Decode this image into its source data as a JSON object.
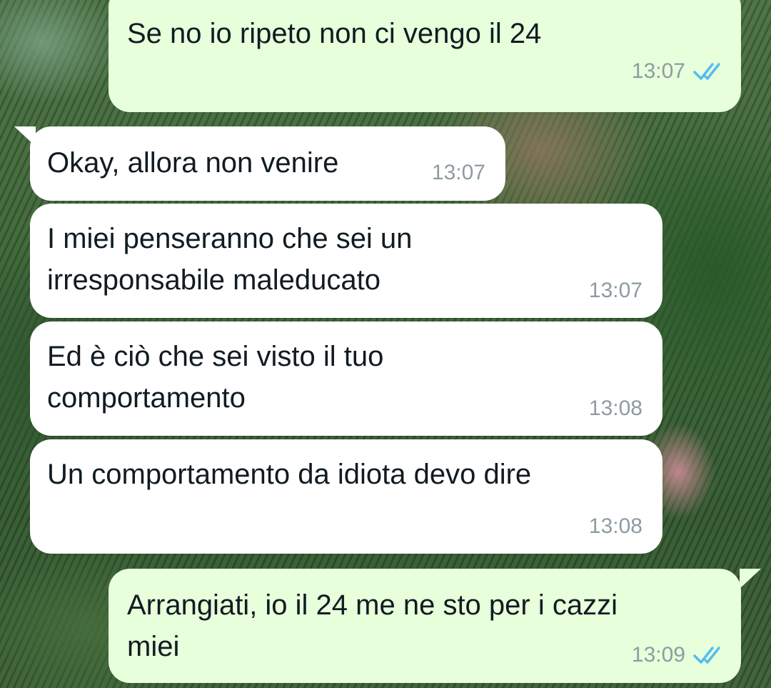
{
  "messages": [
    {
      "text": "Se no io ripeto non ci vengo il 24",
      "time": "13:07",
      "status_icon": "double-check-read"
    },
    {
      "text": "Okay, allora non venire",
      "time": "13:07"
    },
    {
      "text": "I miei penseranno che sei un\nirresponsabile maleducato",
      "time": "13:07"
    },
    {
      "text": "Ed è ciò che sei visto il tuo\ncomportamento",
      "time": "13:08"
    },
    {
      "text": "Un comportamento da idiota devo dire",
      "time": "13:08"
    },
    {
      "text": "Arrangiati, io il 24 me ne sto per i cazzi\nmiei",
      "time": "13:09",
      "status_icon": "double-check-read"
    }
  ],
  "colors": {
    "outgoing_bubble": "#e7ffdb",
    "incoming_bubble": "#ffffff",
    "read_tick": "#53bdeb",
    "meta_text": "#8f9ba1"
  }
}
